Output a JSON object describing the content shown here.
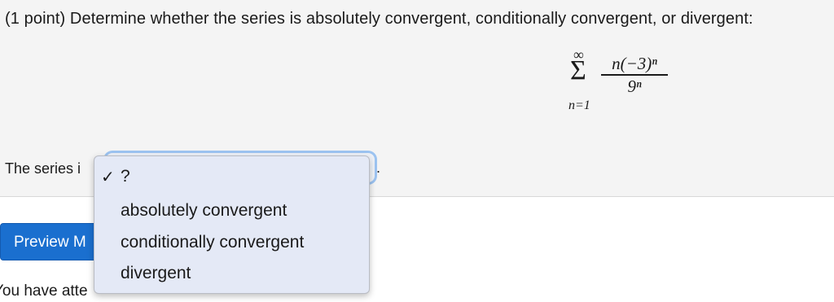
{
  "problem": {
    "prompt": "(1 point) Determine whether the series is absolutely convergent, conditionally convergent, or divergent:"
  },
  "formula": {
    "upper": "∞",
    "sigma": "Σ",
    "lower": "n=1",
    "numerator": "n(−3)ⁿ",
    "denominator": "9ⁿ"
  },
  "answer": {
    "label": "The series i",
    "period": ".",
    "selected_value": "?"
  },
  "dropdown": {
    "check_mark": "✓",
    "options": [
      "?",
      "absolutely convergent",
      "conditionally convergent",
      "divergent"
    ],
    "selected_index": 0
  },
  "preview_button": {
    "label": "Preview M"
  },
  "attempts": {
    "text": "You have atte"
  },
  "colors": {
    "panel_bg": "#f4f4f4",
    "button_bg": "#1a6fcf",
    "dropdown_bg": "#e4e9f6",
    "focus_ring": "#9cc3f0"
  }
}
